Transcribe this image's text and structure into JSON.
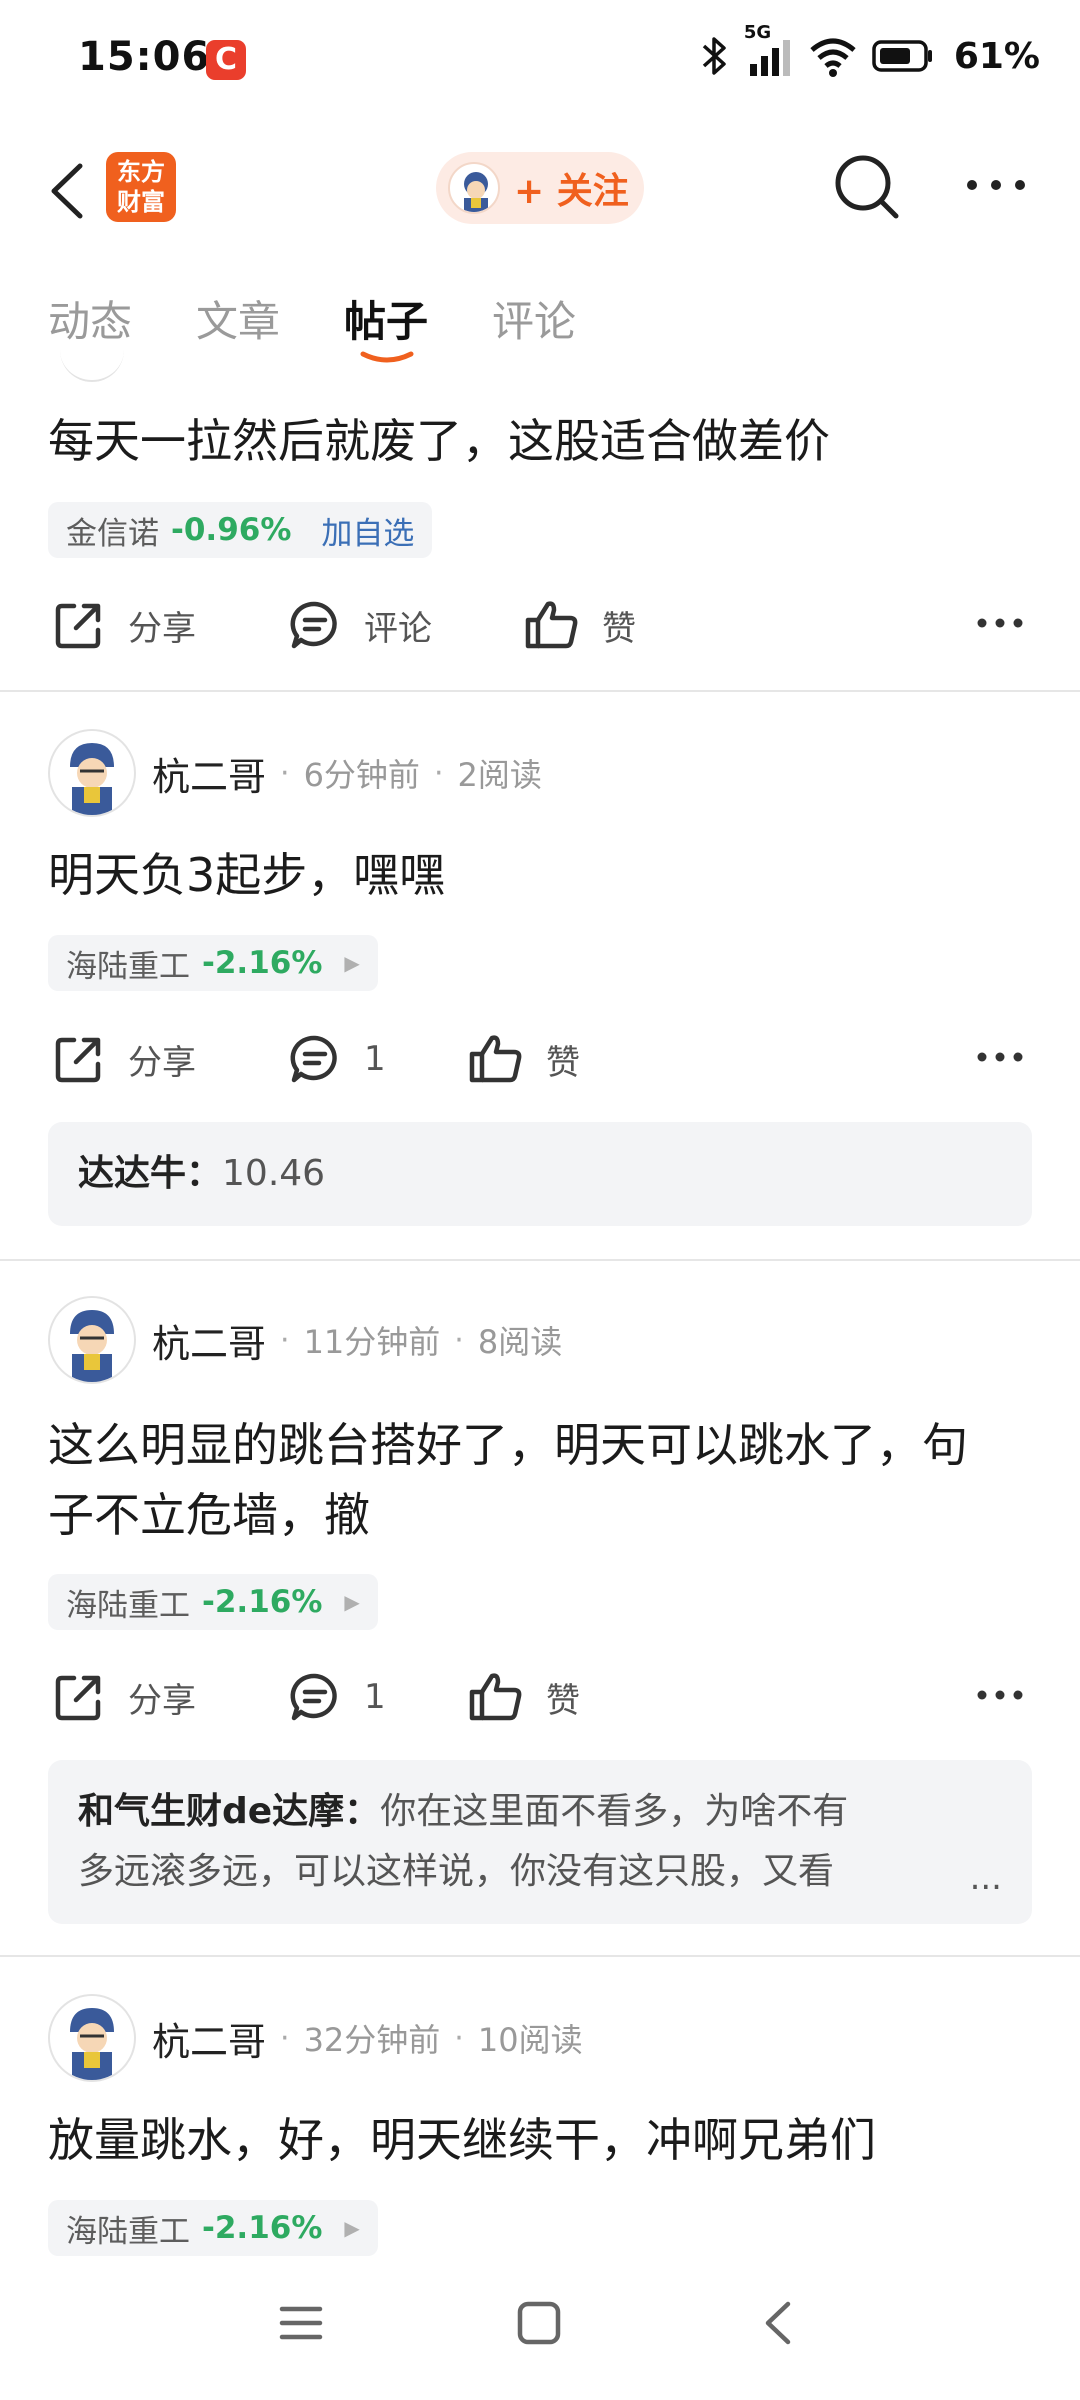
{
  "status_bar": {
    "time": "15:06",
    "app_badge": "C",
    "network": "5G",
    "battery": "61%"
  },
  "nav": {
    "logo_line1": "东方",
    "logo_line2": "财富",
    "follow_label": "+ 关注"
  },
  "tabs": [
    {
      "label": "动态",
      "active": false
    },
    {
      "label": "文章",
      "active": false
    },
    {
      "label": "帖子",
      "active": true
    },
    {
      "label": "评论",
      "active": false
    }
  ],
  "posts": [
    {
      "text": "每天一拉然后就废了，这股适合做差价",
      "stock": {
        "name": "金信诺",
        "change": "-0.96%",
        "add_label": "加自选"
      },
      "actions": {
        "share": "分享",
        "comment": "评论",
        "like": "赞"
      }
    },
    {
      "author": "杭二哥",
      "time": "6分钟前",
      "reads": "2阅读",
      "text": "明天负3起步，嘿嘿",
      "stock": {
        "name": "海陆重工",
        "change": "-2.16%"
      },
      "actions": {
        "share": "分享",
        "comment": "1",
        "like": "赞"
      },
      "comment": {
        "author": "达达牛：",
        "text": "10.46"
      }
    },
    {
      "author": "杭二哥",
      "time": "11分钟前",
      "reads": "8阅读",
      "text_line1": "这么明显的跳台搭好了，明天可以跳水了，句",
      "text_line2": "子不立危墙，撤",
      "stock": {
        "name": "海陆重工",
        "change": "-2.16%"
      },
      "actions": {
        "share": "分享",
        "comment": "1",
        "like": "赞"
      },
      "comment": {
        "author": "和气生财de达摩：",
        "text_line1": "你在这里面不看多，为啥不有",
        "text_line2": "多远滚多远，可以这样说，你没有这只股，又看",
        "more": "..."
      }
    },
    {
      "author": "杭二哥",
      "time": "32分钟前",
      "reads": "10阅读",
      "text": "放量跳水，好，明天继续干，冲啊兄弟们",
      "stock": {
        "name": "海陆重工",
        "change": "-2.16%"
      }
    }
  ],
  "colors": {
    "brand": "#f0601e",
    "down": "#2eaa61",
    "link": "#3b6fb6"
  }
}
